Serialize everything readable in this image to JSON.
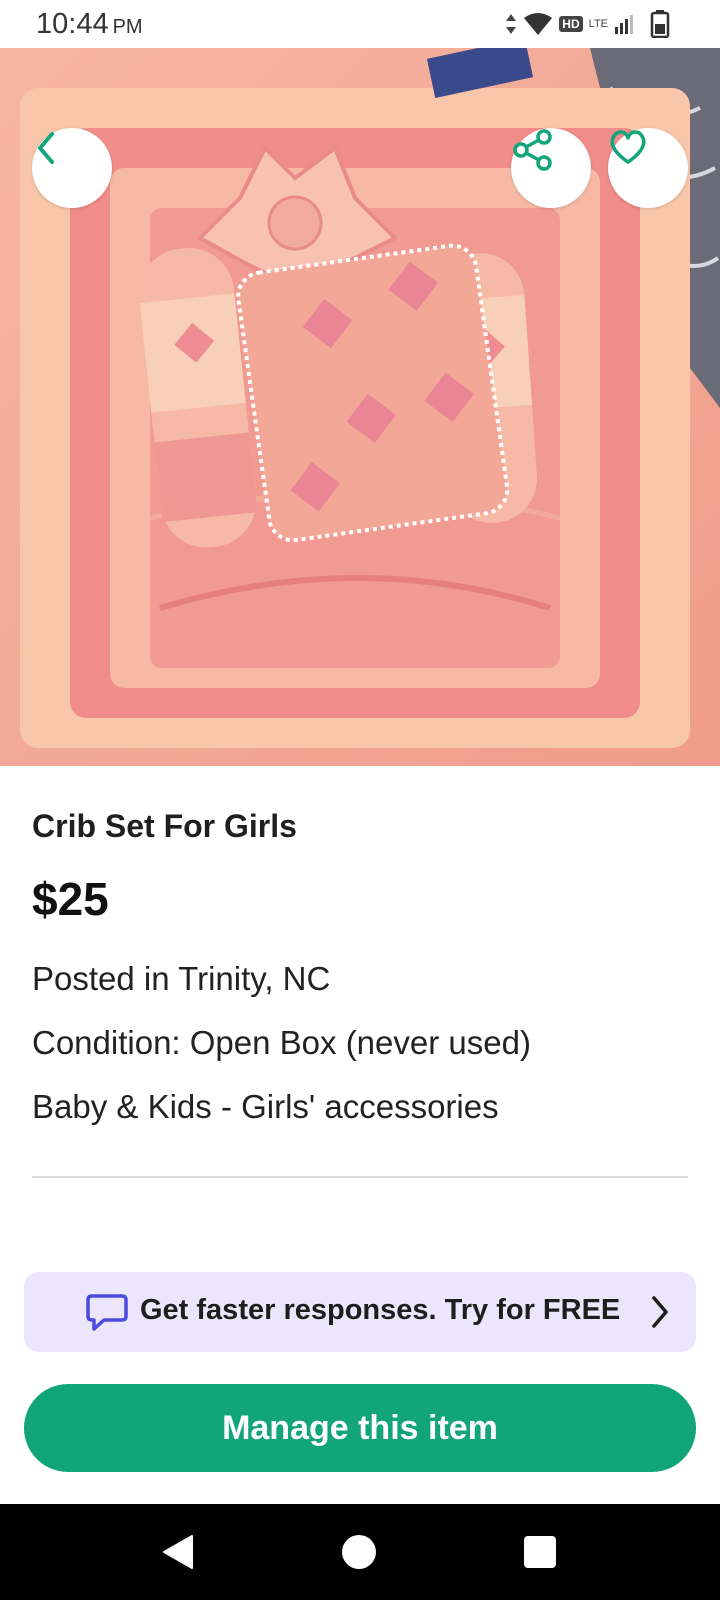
{
  "status_bar": {
    "time": "10:44",
    "ampm": "PM",
    "hd_label": "HD",
    "network_label": "LTE",
    "icons": [
      "data-arrows-icon",
      "wifi-icon",
      "signal-icon",
      "battery-icon"
    ]
  },
  "hero": {
    "image_icon": "product-photo",
    "buttons": {
      "back": "back-chevron-icon",
      "share": "share-icon",
      "favorite": "heart-icon"
    },
    "accent_color": "#12a57a"
  },
  "listing": {
    "title": "Crib Set For Girls",
    "price": "$25",
    "posted": "Posted in Trinity, NC",
    "condition": "Condition: Open Box (never used)",
    "category": "Baby & Kids - Girls' accessories"
  },
  "promo": {
    "text": "Get faster responses. Try for FREE",
    "icon": "chat-bubble-icon",
    "chevron": "chevron-right-icon",
    "background": "#ebe6fb",
    "icon_color": "#4a4adf"
  },
  "cta": {
    "label": "Manage this item",
    "color": "#12a57a"
  },
  "nav_bar": {
    "icons": [
      "nav-back-icon",
      "nav-home-icon",
      "nav-recents-icon"
    ]
  }
}
